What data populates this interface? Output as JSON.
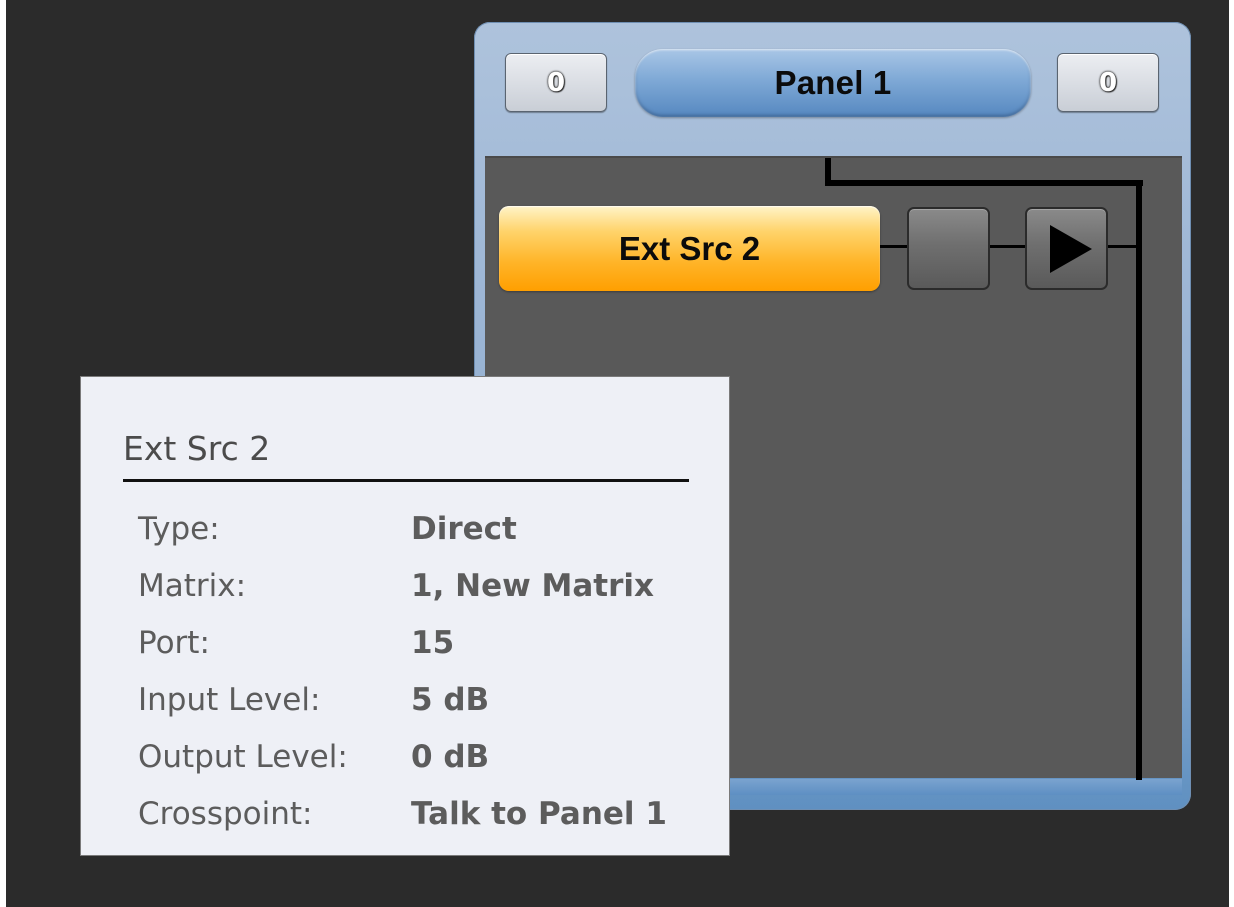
{
  "panel": {
    "title": "Panel 1",
    "left_counter": "0",
    "right_counter": "0",
    "source_button_label": "Ext Src 2",
    "colors": {
      "frame": "#9db6d5",
      "body": "#595959",
      "source_button": "#ffb52a"
    },
    "icons": {
      "blank_button": "blank-square-icon",
      "play_button": "play-icon"
    }
  },
  "tooltip": {
    "title": "Ext Src 2",
    "rows": [
      {
        "label": "Type:",
        "value": "Direct"
      },
      {
        "label": "Matrix:",
        "value": "1, New Matrix"
      },
      {
        "label": "Port:",
        "value": "15"
      },
      {
        "label": "Input Level:",
        "value": "5 dB"
      },
      {
        "label": "Output Level:",
        "value": "0 dB"
      },
      {
        "label": "Crosspoint:",
        "value": "Talk to Panel 1"
      }
    ]
  }
}
